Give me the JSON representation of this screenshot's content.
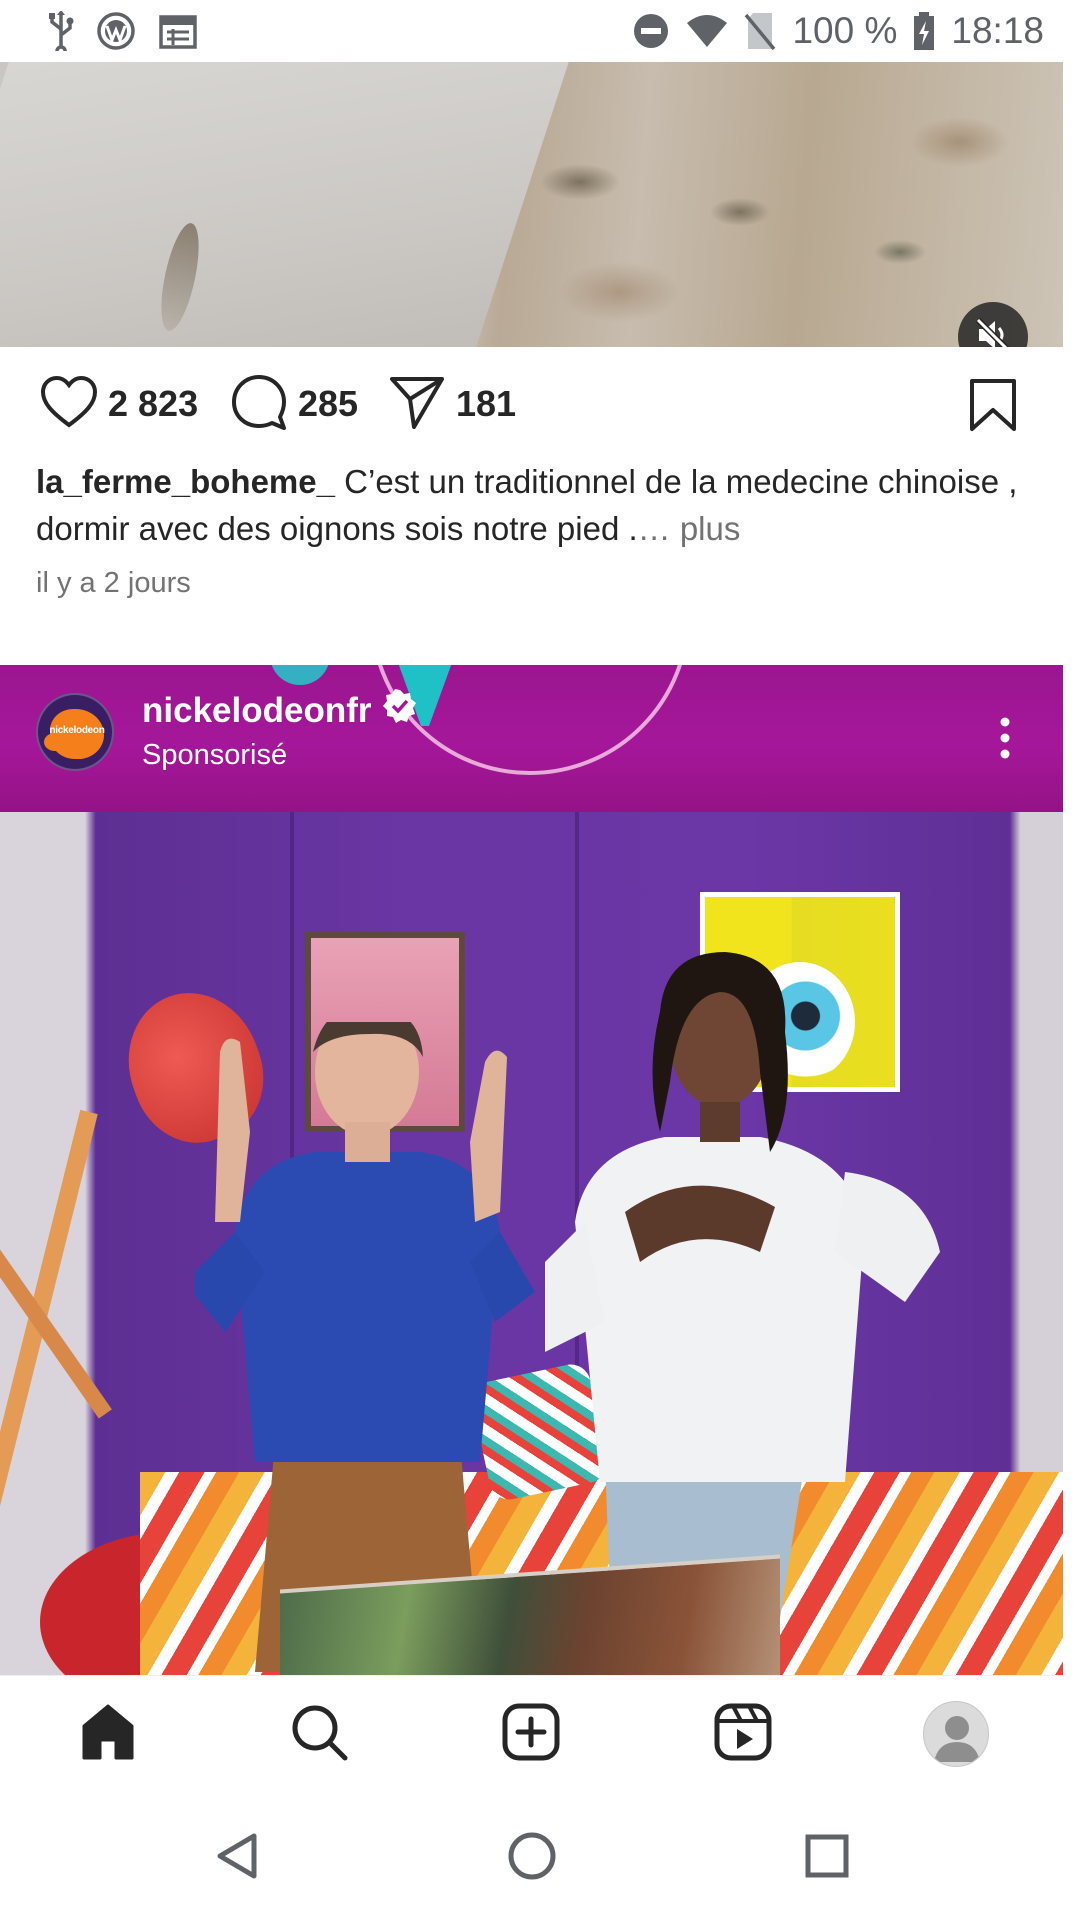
{
  "status_bar": {
    "battery": "100 %",
    "time": "18:18",
    "icons": [
      "usb-icon",
      "wordpress-icon",
      "calendar-icon",
      "do-not-disturb-icon",
      "wifi-icon",
      "no-sim-icon",
      "battery-charging-icon"
    ]
  },
  "previous_post": {
    "mute_icon": "volume-off-icon",
    "likes": "2 823",
    "comments": "285",
    "shares": "181",
    "caption_user": "la_ferme_boheme_",
    "caption_text": " C’est un traditionnel de la medecine chinoise , dormir avec des oignons sois notre pied .",
    "caption_more": "… plus",
    "timestamp": "il y a 2 jours"
  },
  "sponsored_post": {
    "account": "nickelodeonfr",
    "subtitle": "Sponsorisé",
    "avatar_text": "nickelodeon",
    "verified_icon": "verified-badge-icon",
    "more_icon": "more-vertical-icon"
  },
  "bottom_nav": {
    "items": [
      "home-icon",
      "search-icon",
      "create-icon",
      "reels-icon",
      "profile-icon"
    ]
  },
  "system_nav": {
    "items": [
      "back-icon",
      "home-circle-icon",
      "recents-icon"
    ]
  },
  "colors": {
    "text": "#262626",
    "secondary_text": "#737373",
    "header_magenta": "#a5179a",
    "nickelodeon_orange": "#f57f1b"
  }
}
